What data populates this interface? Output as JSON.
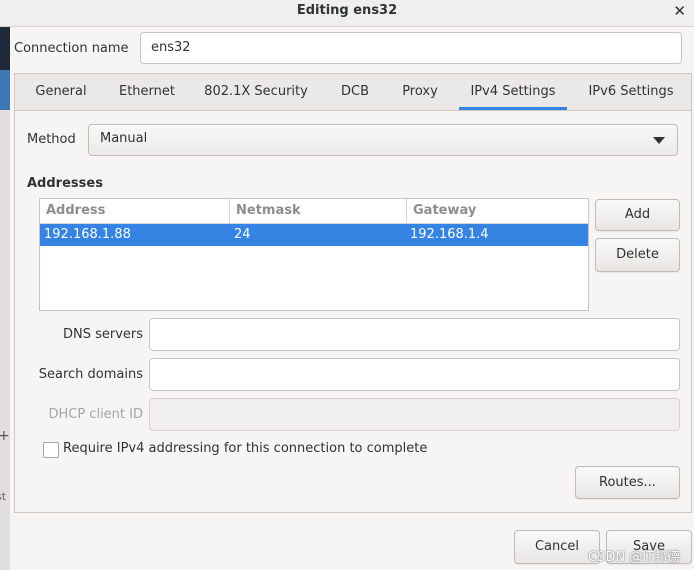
{
  "window": {
    "title": "Editing ens32"
  },
  "connection": {
    "label": "Connection name",
    "value": "ens32"
  },
  "tabs": [
    {
      "label": "General"
    },
    {
      "label": "Ethernet"
    },
    {
      "label": "802.1X Security"
    },
    {
      "label": "DCB"
    },
    {
      "label": "Proxy"
    },
    {
      "label": "IPv4 Settings",
      "active": true
    },
    {
      "label": "IPv6 Settings"
    }
  ],
  "ipv4": {
    "method_label": "Method",
    "method_value": "Manual",
    "addresses_heading": "Addresses",
    "columns": [
      "Address",
      "Netmask",
      "Gateway"
    ],
    "rows": [
      {
        "address": "192.168.1.88",
        "netmask": "24",
        "gateway": "192.168.1.4"
      }
    ],
    "add_label": "Add",
    "delete_label": "Delete",
    "dns_label": "DNS servers",
    "dns_value": "",
    "search_label": "Search domains",
    "search_value": "",
    "dhcp_label": "DHCP client ID",
    "dhcp_value": "",
    "require_label": "Require IPv4 addressing for this connection to complete",
    "require_checked": false,
    "routes_label": "Routes..."
  },
  "footer": {
    "cancel_label": "Cancel",
    "save_label": "Save"
  },
  "watermark": "CSDN @IT邦德",
  "colors": {
    "accent": "#3584e4"
  }
}
